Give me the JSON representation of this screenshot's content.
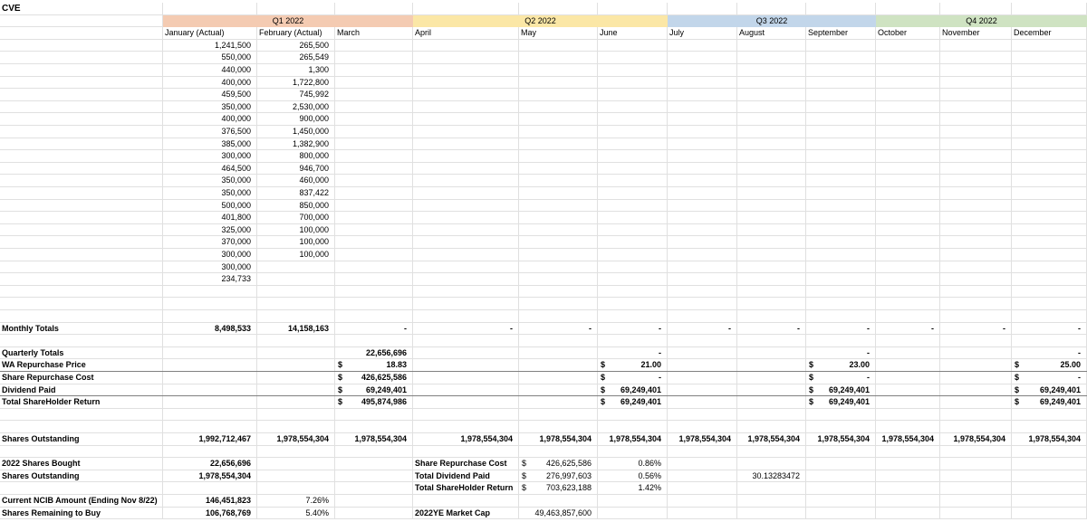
{
  "title": "CVE",
  "quarters": [
    {
      "label": "Q1 2022",
      "color": "#f4cbb2"
    },
    {
      "label": "Q2 2022",
      "color": "#fbe7a6"
    },
    {
      "label": "Q3 2022",
      "color": "#c2d6ea"
    },
    {
      "label": "Q4 2022",
      "color": "#cfe3c2"
    }
  ],
  "months": [
    "January (Actual)",
    "February (Actual)",
    "March",
    "April",
    "May",
    "June",
    "July",
    "August",
    "September",
    "October",
    "November",
    "December"
  ],
  "jan_values": [
    "1,241,500",
    "550,000",
    "440,000",
    "400,000",
    "459,500",
    "350,000",
    "400,000",
    "376,500",
    "385,000",
    "300,000",
    "464,500",
    "350,000",
    "350,000",
    "500,000",
    "401,800",
    "325,000",
    "370,000",
    "300,000",
    "300,000",
    "234,733"
  ],
  "feb_values": [
    "265,500",
    "265,549",
    "1,300",
    "1,722,800",
    "745,992",
    "2,530,000",
    "900,000",
    "1,450,000",
    "1,382,900",
    "800,000",
    "946,700",
    "460,000",
    "837,422",
    "850,000",
    "700,000",
    "100,000",
    "100,000",
    "100,000"
  ],
  "monthly_totals": {
    "label": "Monthly Totals",
    "values": [
      "8,498,533",
      "14,158,163",
      "-",
      "-",
      "-",
      "-",
      "-",
      "-",
      "-",
      "-",
      "-",
      "-"
    ]
  },
  "quarterly_totals": {
    "label": "Quarterly Totals",
    "values": [
      "22,656,696",
      "-",
      "-",
      "-"
    ]
  },
  "wa_price": {
    "label": "WA Repurchase Price",
    "values": [
      "18.83",
      "21.00",
      "23.00",
      "25.00"
    ]
  },
  "repurchase_cost": {
    "label": "Share Repurchase Cost",
    "values": [
      "426,625,586",
      "-",
      "-",
      "-"
    ]
  },
  "dividend_paid": {
    "label": "Dividend Paid",
    "values": [
      "69,249,401",
      "69,249,401",
      "69,249,401",
      "69,249,401"
    ]
  },
  "total_return": {
    "label": "Total ShareHolder Return",
    "values": [
      "495,874,986",
      "69,249,401",
      "69,249,401",
      "69,249,401"
    ]
  },
  "currency_symbol": "$",
  "shares_outstanding_row": {
    "label": "Shares Outstanding",
    "values": [
      "1,992,712,467",
      "1,978,554,304",
      "1,978,554,304",
      "1,978,554,304",
      "1,978,554,304",
      "1,978,554,304",
      "1,978,554,304",
      "1,978,554,304",
      "1,978,554,304",
      "1,978,554,304",
      "1,978,554,304",
      "1,978,554,304"
    ]
  },
  "summary_left": [
    {
      "label": "2022 Shares Bought",
      "value": "22,656,696"
    },
    {
      "label": "Shares Outstanding",
      "value": "1,978,554,304"
    }
  ],
  "summary_mid": [
    {
      "label": "Share Repurchase Cost",
      "value": "426,625,586",
      "pct": "0.86%"
    },
    {
      "label": "Total Dividend Paid",
      "value": "276,997,603",
      "pct": "0.56%"
    },
    {
      "label": "Total ShareHolder Return",
      "value": "703,623,188",
      "pct": "1.42%"
    }
  ],
  "aug_note": "30.13283472",
  "ncib": [
    {
      "label": "Current NCIB Amount (Ending Nov 8/22)",
      "value": "146,451,823",
      "pct": "7.26%"
    },
    {
      "label": "Shares Remaining to Buy",
      "value": "106,768,769",
      "pct": "5.40%"
    }
  ],
  "market_cap": {
    "label": "2022YE Market Cap",
    "value": "49,463,857,600"
  }
}
